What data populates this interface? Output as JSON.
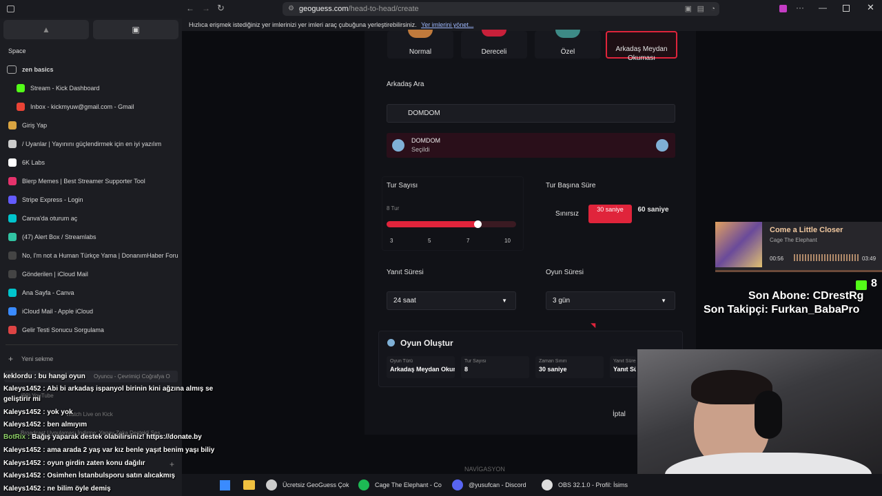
{
  "browser": {
    "url_host": "geoguess.com",
    "url_path": "/head-to-head/create",
    "bookmark_hint": "Hızlıca erişmek istediğiniz yer imlerinizi yer imleri araç çubuğuna yerleştirebilirsiniz.",
    "bookmark_link": "Yer imlerini yönet..."
  },
  "sidebar": {
    "space_label": "Space",
    "folder": "zen basics",
    "items": [
      {
        "label": "Stream - Kick Dashboard",
        "color": "#53fc18"
      },
      {
        "label": "Inbox - kickmyuw@gmail.com - Gmail",
        "color": "#ea4335"
      },
      {
        "label": "Giriş Yap",
        "color": "#d9a441"
      },
      {
        "label": "/ Uyanlar | Yayınını güçlendirmek için en iyi yazılım",
        "color": "#cccccc"
      },
      {
        "label": "6K Labs",
        "color": "#ffffff"
      },
      {
        "label": "Blerp Memes | Best Streamer Supporter Tool",
        "color": "#e5326b"
      },
      {
        "label": "Stripe Express - Login",
        "color": "#635bff"
      },
      {
        "label": "Canva'da oturum aç",
        "color": "#00c4cc"
      },
      {
        "label": "(47) Alert Box / Streamlabs",
        "color": "#31c3a2"
      },
      {
        "label": "No, I'm not a Human Türkçe Yama | DonanımHaber Foru",
        "color": "#444444"
      },
      {
        "label": "Gönderilen | iCloud Mail",
        "color": "#444444"
      },
      {
        "label": "Ana Sayfa - Canva",
        "color": "#00c4cc"
      },
      {
        "label": "iCloud Mail - Apple iCloud",
        "color": "#3a8bff"
      },
      {
        "label": "Gelir Testi Sonucu Sorgulama",
        "color": "#d44"
      }
    ],
    "new_tab": "Yeni sekme",
    "bg_tabs": [
      "Oyuncu - Çevrimiçi Coğrafya O",
      "(90) YouTube",
      "Watch Live on Kick",
      "Broadcast Uygulaması İndirme: Yapay Zeka Destekli Ses"
    ]
  },
  "game": {
    "modes": [
      {
        "label": "Normal",
        "selected": false
      },
      {
        "label": "Dereceli",
        "selected": false
      },
      {
        "label": "Özel",
        "selected": false
      },
      {
        "label": "Arkadaş Meydan Okuması",
        "selected": true
      }
    ],
    "friend_search_label": "Arkadaş Ara",
    "friend_search_value": "DOMDOM",
    "selected_friend_name": "DOMDOM",
    "selected_friend_status": "Seçildi",
    "rounds_label": "Tur Sayısı",
    "rounds_value_text": "8 Tur",
    "rounds_fraction": 0.71,
    "rounds_ticks": [
      "3",
      "5",
      "7",
      "10"
    ],
    "time_per_round_label": "Tur Başına Süre",
    "time_options": [
      {
        "label": "Sınırsız",
        "selected": false
      },
      {
        "label": "30 saniye",
        "selected": true
      },
      {
        "label": "60 saniye",
        "selected": false
      }
    ],
    "answer_time_label": "Yanıt Süresi",
    "answer_time_value": "24 saat",
    "game_time_label": "Oyun Süresi",
    "game_time_value": "3 gün",
    "summary_title": "Oyun Oluştur",
    "summary": [
      {
        "key": "Oyun Türü",
        "value": "Arkadaş Meydan Okuması"
      },
      {
        "key": "Tur Sayısı",
        "value": "8"
      },
      {
        "key": "Zaman Sınırı",
        "value": "30 saniye"
      },
      {
        "key": "Yanıt Süresi",
        "value": "Yanıt Süresi"
      }
    ],
    "cancel_label": "İptal",
    "footer_label": "NAVİGASYON",
    "accent": "#e0243b"
  },
  "chat": [
    {
      "user": "keklordu",
      "text": "bu hangi oyun"
    },
    {
      "user": "Kaleys1452",
      "text": "Abi bi arkadaş ispanyol birinin kini ağzına almış se"
    },
    {
      "user": "",
      "text": "geliştirir mi"
    },
    {
      "user": "Kaleys1452",
      "text": "yok yok"
    },
    {
      "user": "Kaleys1452",
      "text": "ben almıyım"
    },
    {
      "user": "BotRix",
      "text": "Bağış yaparak destek olabilirsiniz! https://donate.by"
    },
    {
      "user": "Kaleys1452",
      "text": "ama arada 2 yaş var kız benle yaşıt benim yaşı biliy"
    },
    {
      "user": "Kaleys1452",
      "text": "oyun girdin zaten konu dağılır"
    },
    {
      "user": "Kaleys1452",
      "text": "Osimhen İstanbulsporu satın alıcakmış"
    },
    {
      "user": "Kaleys1452",
      "text": "ne bilim öyle demiş"
    }
  ],
  "spotify": {
    "title": "Come a Little Closer",
    "artist": "Cage The Elephant",
    "time_current": "00:56",
    "time_total": "03:49"
  },
  "stream_overlay": {
    "kick_count": "8",
    "last_sub": "Son Abone: CDrestRg",
    "last_follower": "Son Takipçi: Furkan_BabaPro"
  },
  "taskbar": [
    {
      "label": "Ücretsiz GeoGuess Çok",
      "color": "#cccccc"
    },
    {
      "label": "Cage The Elephant - Co",
      "color": "#1db954"
    },
    {
      "label": "@yusufcan - Discord",
      "color": "#5865f2"
    },
    {
      "label": "OBS 32.1.0 - Profil: İsims",
      "color": "#dddddd"
    }
  ]
}
